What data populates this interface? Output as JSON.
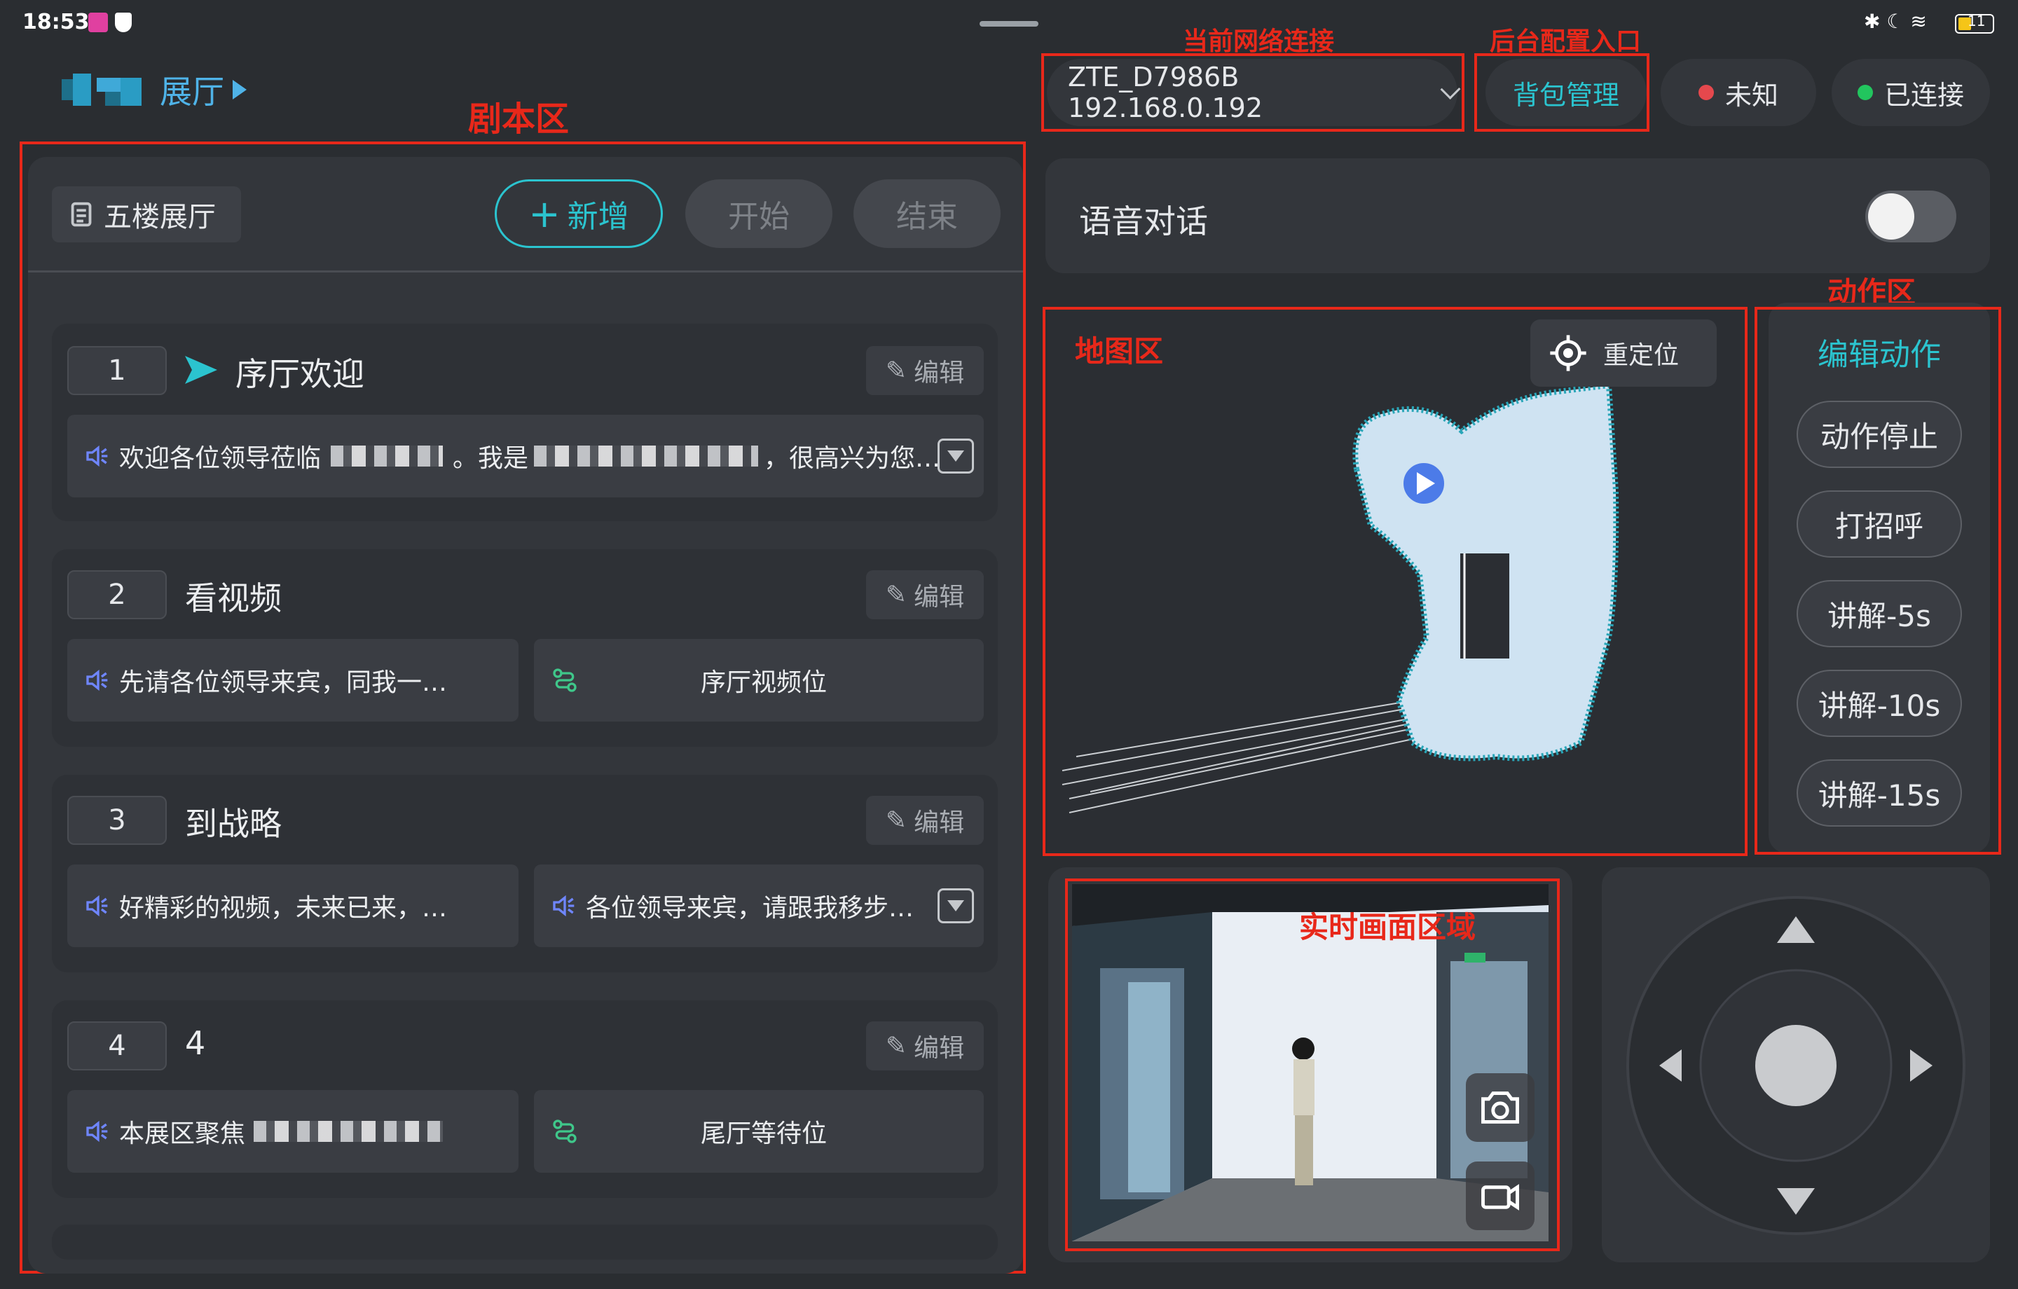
{
  "status_bar": {
    "time": "18:53",
    "battery": "11"
  },
  "brand": {
    "title": "展厅"
  },
  "annotations": {
    "script_area": "剧本区",
    "network": "当前网络连接",
    "backend": "后台配置入口",
    "map_area": "地图区",
    "action_area": "动作区",
    "live_area": "实时画面区域"
  },
  "script_panel": {
    "hall_name": "五楼展厅",
    "add_label": "新增",
    "start_label": "开始",
    "end_label": "结束",
    "edit_label": "编辑",
    "items": [
      {
        "num": "1",
        "title": "序厅欢迎",
        "speech": "欢迎各位领导莅临",
        "speech_mid": "。我是",
        "speech_tail": "，很高兴为您…"
      },
      {
        "num": "2",
        "title": "看视频",
        "speech": "先请各位领导来宾，同我一…",
        "nav": "序厅视频位"
      },
      {
        "num": "3",
        "title": "到战略",
        "speech": "好精彩的视频，未来已来，…",
        "speech2": "各位领导来宾，请跟我移步…"
      },
      {
        "num": "4",
        "title": "4",
        "speech": "本展区聚焦",
        "nav": "尾厅等待位"
      }
    ]
  },
  "header": {
    "network": "ZTE_D7986B 192.168.0.192",
    "backpack_label": "背包管理",
    "status_unknown": "未知",
    "status_connected": "已连接",
    "colors": {
      "unknown": "#e5484d",
      "connected": "#22c55e",
      "accent": "#2bc4cf"
    }
  },
  "voice": {
    "label": "语音对话",
    "enabled": false
  },
  "map": {
    "relocate_label": "重定位"
  },
  "actions": {
    "title": "编辑动作",
    "buttons": [
      "动作停止",
      "打招呼",
      "讲解-5s",
      "讲解-10s",
      "讲解-15s"
    ]
  },
  "video": {
    "exit_sign": "出口"
  },
  "icons": [
    "speaker-icon",
    "route-icon",
    "pencil-icon",
    "locate-icon",
    "camera-icon",
    "video-icon",
    "chevron-down-icon",
    "doc-icon",
    "plus-icon"
  ]
}
